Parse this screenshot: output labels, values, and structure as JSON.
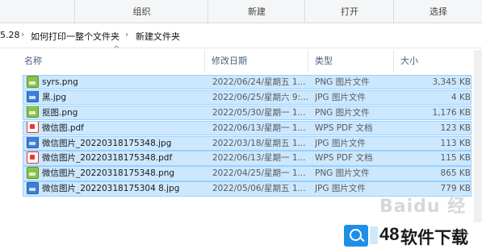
{
  "ribbon": {
    "groups": [
      "组织",
      "新建",
      "打开",
      "选择"
    ]
  },
  "address": {
    "crumbs": [
      "5.28",
      "如何打印一整个文件夹",
      "新建文件夹"
    ]
  },
  "columns": {
    "name": "名称",
    "date": "修改日期",
    "type": "类型",
    "size": "大小"
  },
  "files": [
    {
      "name": "syrs.png",
      "date": "2022/06/24/星期五 1...",
      "type": "PNG 图片文件",
      "size": "3,345 KB",
      "icon": "png-file-icon"
    },
    {
      "name": "黑.jpg",
      "date": "2022/06/25/星期六 9:...",
      "type": "JPG 图片文件",
      "size": "4 KB",
      "icon": "jpg-file-icon"
    },
    {
      "name": "抠图.png",
      "date": "2022/05/30/星期一 1...",
      "type": "PNG 图片文件",
      "size": "1,176 KB",
      "icon": "png-file-icon"
    },
    {
      "name": "微信图.pdf",
      "date": "2022/06/13/星期一 1...",
      "type": "WPS PDF 文档",
      "size": "123 KB",
      "icon": "pdf-file-icon"
    },
    {
      "name": "微信图片_20220318175348.jpg",
      "date": "2022/03/18/星期五 1...",
      "type": "JPG 图片文件",
      "size": "113 KB",
      "icon": "jpg-file-icon"
    },
    {
      "name": "微信图片_20220318175348.pdf",
      "date": "2022/06/13/星期一 1...",
      "type": "WPS PDF 文档",
      "size": "115 KB",
      "icon": "pdf-file-icon"
    },
    {
      "name": "微信图片_20220318175348.png",
      "date": "2022/04/25/星期一 1...",
      "type": "PNG 图片文件",
      "size": "865 KB",
      "icon": "png-file-icon"
    },
    {
      "name": "微信图片_20220318175304 8.jpg",
      "date": "2022/05/06/星期五 1...",
      "type": "JPG 图片文件",
      "size": "779 KB",
      "icon": "jpg-file-icon"
    }
  ],
  "watermark": {
    "text": "Baidu 经验"
  },
  "banner": {
    "number": "48",
    "text": "软件下载"
  },
  "colors": {
    "selection": "#cce8ff",
    "selection_border": "#99d1ff",
    "header_text": "#4c607a"
  }
}
